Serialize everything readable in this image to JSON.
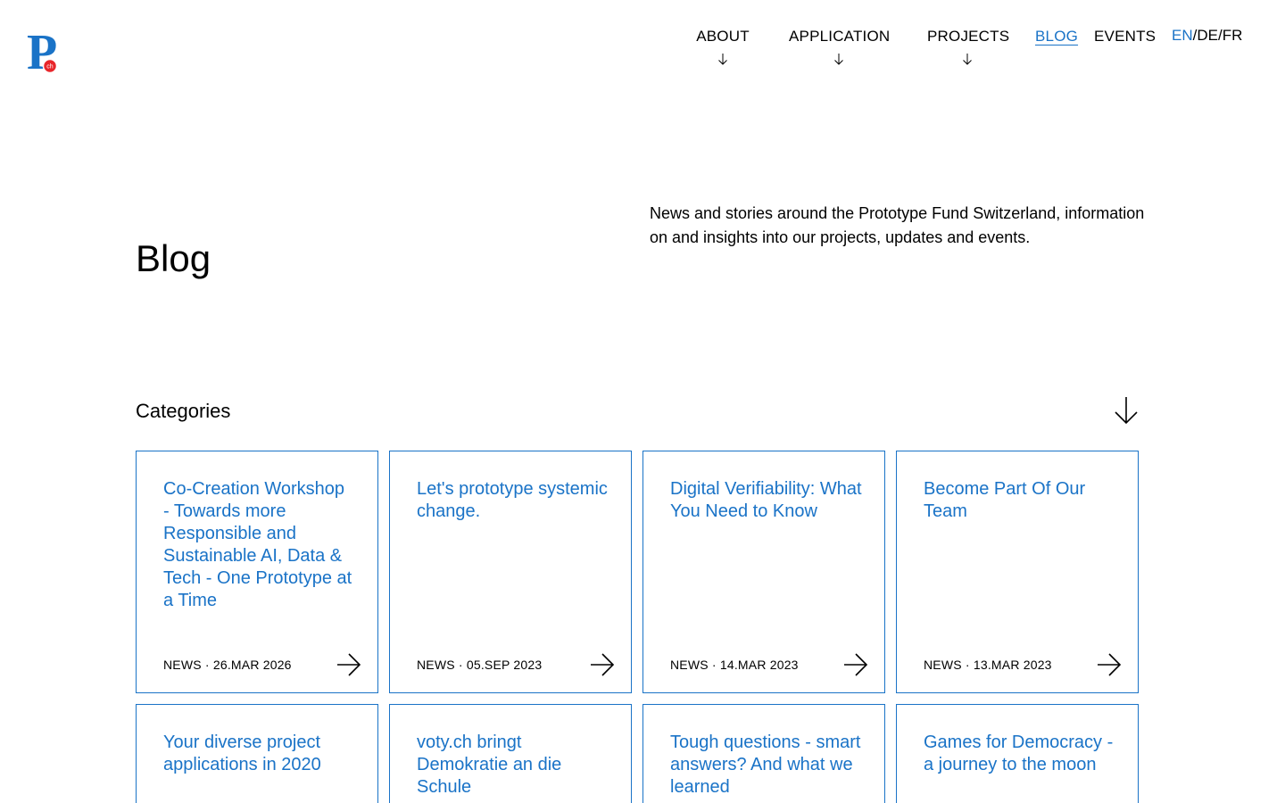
{
  "brand": {
    "logo_letter": "P",
    "logo_badge": "ch"
  },
  "nav": {
    "items": [
      {
        "label": "ABOUT",
        "has_dropdown": true,
        "active": false
      },
      {
        "label": "APPLICATION",
        "has_dropdown": true,
        "active": false
      },
      {
        "label": "PROJECTS",
        "has_dropdown": true,
        "active": false
      },
      {
        "label": "BLOG",
        "has_dropdown": false,
        "active": true
      },
      {
        "label": "EVENTS",
        "has_dropdown": false,
        "active": false
      }
    ],
    "languages": {
      "en": "EN",
      "de": "DE",
      "fr": "FR",
      "separator": "/",
      "active": "EN"
    }
  },
  "page": {
    "title": "Blog",
    "intro": "News and stories around the Prototype Fund Switzerland, information on and insights into our projects, updates and events."
  },
  "categories": {
    "label": "Categories"
  },
  "posts": [
    {
      "title": "Co-Creation Workshop - Towards more Responsible and Sustainable AI, Data & Tech - One Prototype at a Time",
      "category": "NEWS",
      "date": "26.MAR 2026"
    },
    {
      "title": "Let's prototype systemic change.",
      "category": "NEWS",
      "date": "05.SEP 2023"
    },
    {
      "title": "Digital Verifiability: What You Need to Know",
      "category": "NEWS",
      "date": "14.MAR 2023"
    },
    {
      "title": "Become Part Of Our Team",
      "category": "NEWS",
      "date": "13.MAR 2023"
    },
    {
      "title": "Your diverse project applications in 2020",
      "category": "",
      "date": ""
    },
    {
      "title": "voty.ch bringt Demokratie an die Schule",
      "category": "",
      "date": ""
    },
    {
      "title": "Tough questions - smart answers? And what we learned",
      "category": "",
      "date": ""
    },
    {
      "title": "Games for Democracy - a journey to the moon",
      "category": "",
      "date": ""
    }
  ],
  "colors": {
    "accent": "#1a73c7",
    "badge": "#e8262b",
    "text": "#000000",
    "background": "#ffffff"
  },
  "icons": {
    "nav_dropdown": "arrow-down-icon",
    "categories_toggle": "arrow-down-icon",
    "card_link": "arrow-right-icon"
  }
}
